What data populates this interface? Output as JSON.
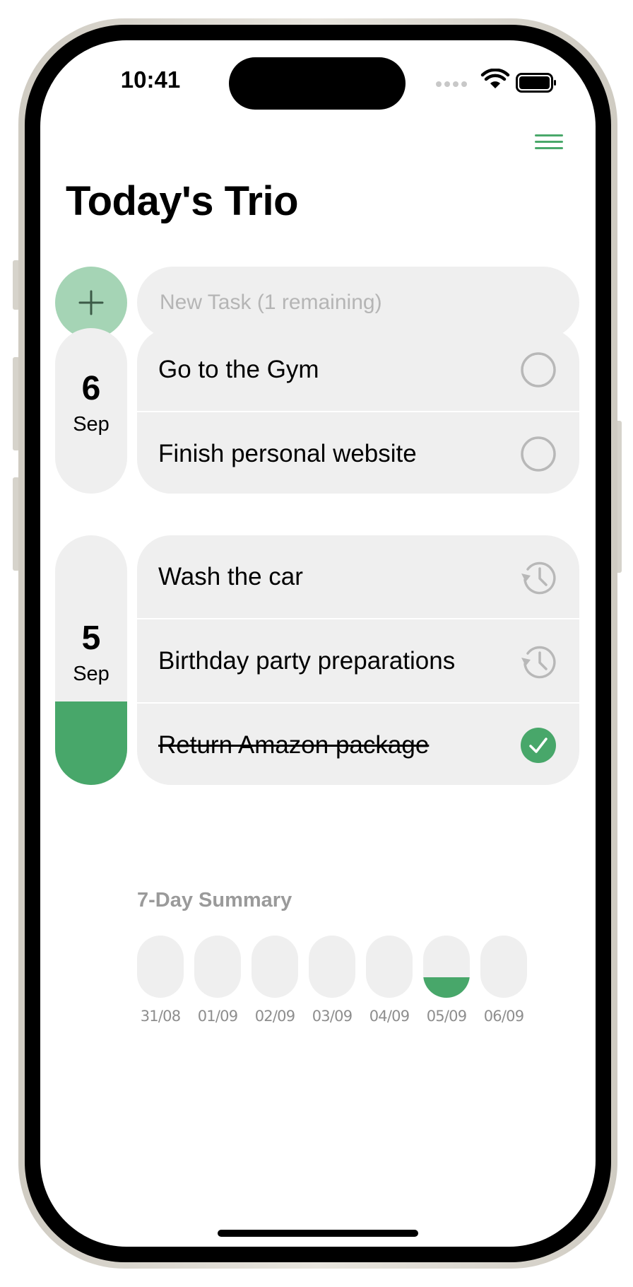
{
  "status_bar": {
    "time": "10:41"
  },
  "header": {
    "title": "Today's Trio",
    "menu_icon": "hamburger-menu-icon"
  },
  "new_task": {
    "placeholder": "New Task (1 remaining)",
    "add_icon": "plus-icon"
  },
  "days": [
    {
      "day": "6",
      "month": "Sep",
      "completion": 0,
      "tasks": [
        {
          "label": "Go to the Gym",
          "state": "open",
          "icon": "empty-circle-icon"
        },
        {
          "label": "Finish personal website",
          "state": "open",
          "icon": "empty-circle-icon"
        }
      ]
    },
    {
      "day": "5",
      "month": "Sep",
      "completion": 0.333,
      "tasks": [
        {
          "label": "Wash the car",
          "state": "postponed",
          "icon": "history-clock-icon"
        },
        {
          "label": "Birthday party preparations",
          "state": "postponed",
          "icon": "history-clock-icon"
        },
        {
          "label": "Return Amazon package",
          "state": "done",
          "icon": "checkmark-circle-icon"
        }
      ]
    }
  ],
  "summary": {
    "title": "7-Day Summary",
    "days": [
      {
        "label": "31/08",
        "completion": 0
      },
      {
        "label": "01/09",
        "completion": 0
      },
      {
        "label": "02/09",
        "completion": 0
      },
      {
        "label": "03/09",
        "completion": 0
      },
      {
        "label": "04/09",
        "completion": 0
      },
      {
        "label": "05/09",
        "completion": 0.333
      },
      {
        "label": "06/09",
        "completion": 0
      }
    ]
  },
  "colors": {
    "accent": "#48a76a",
    "accent_light": "#a5d4b5",
    "surface": "#efefef",
    "muted_text": "#9a9a9a"
  }
}
